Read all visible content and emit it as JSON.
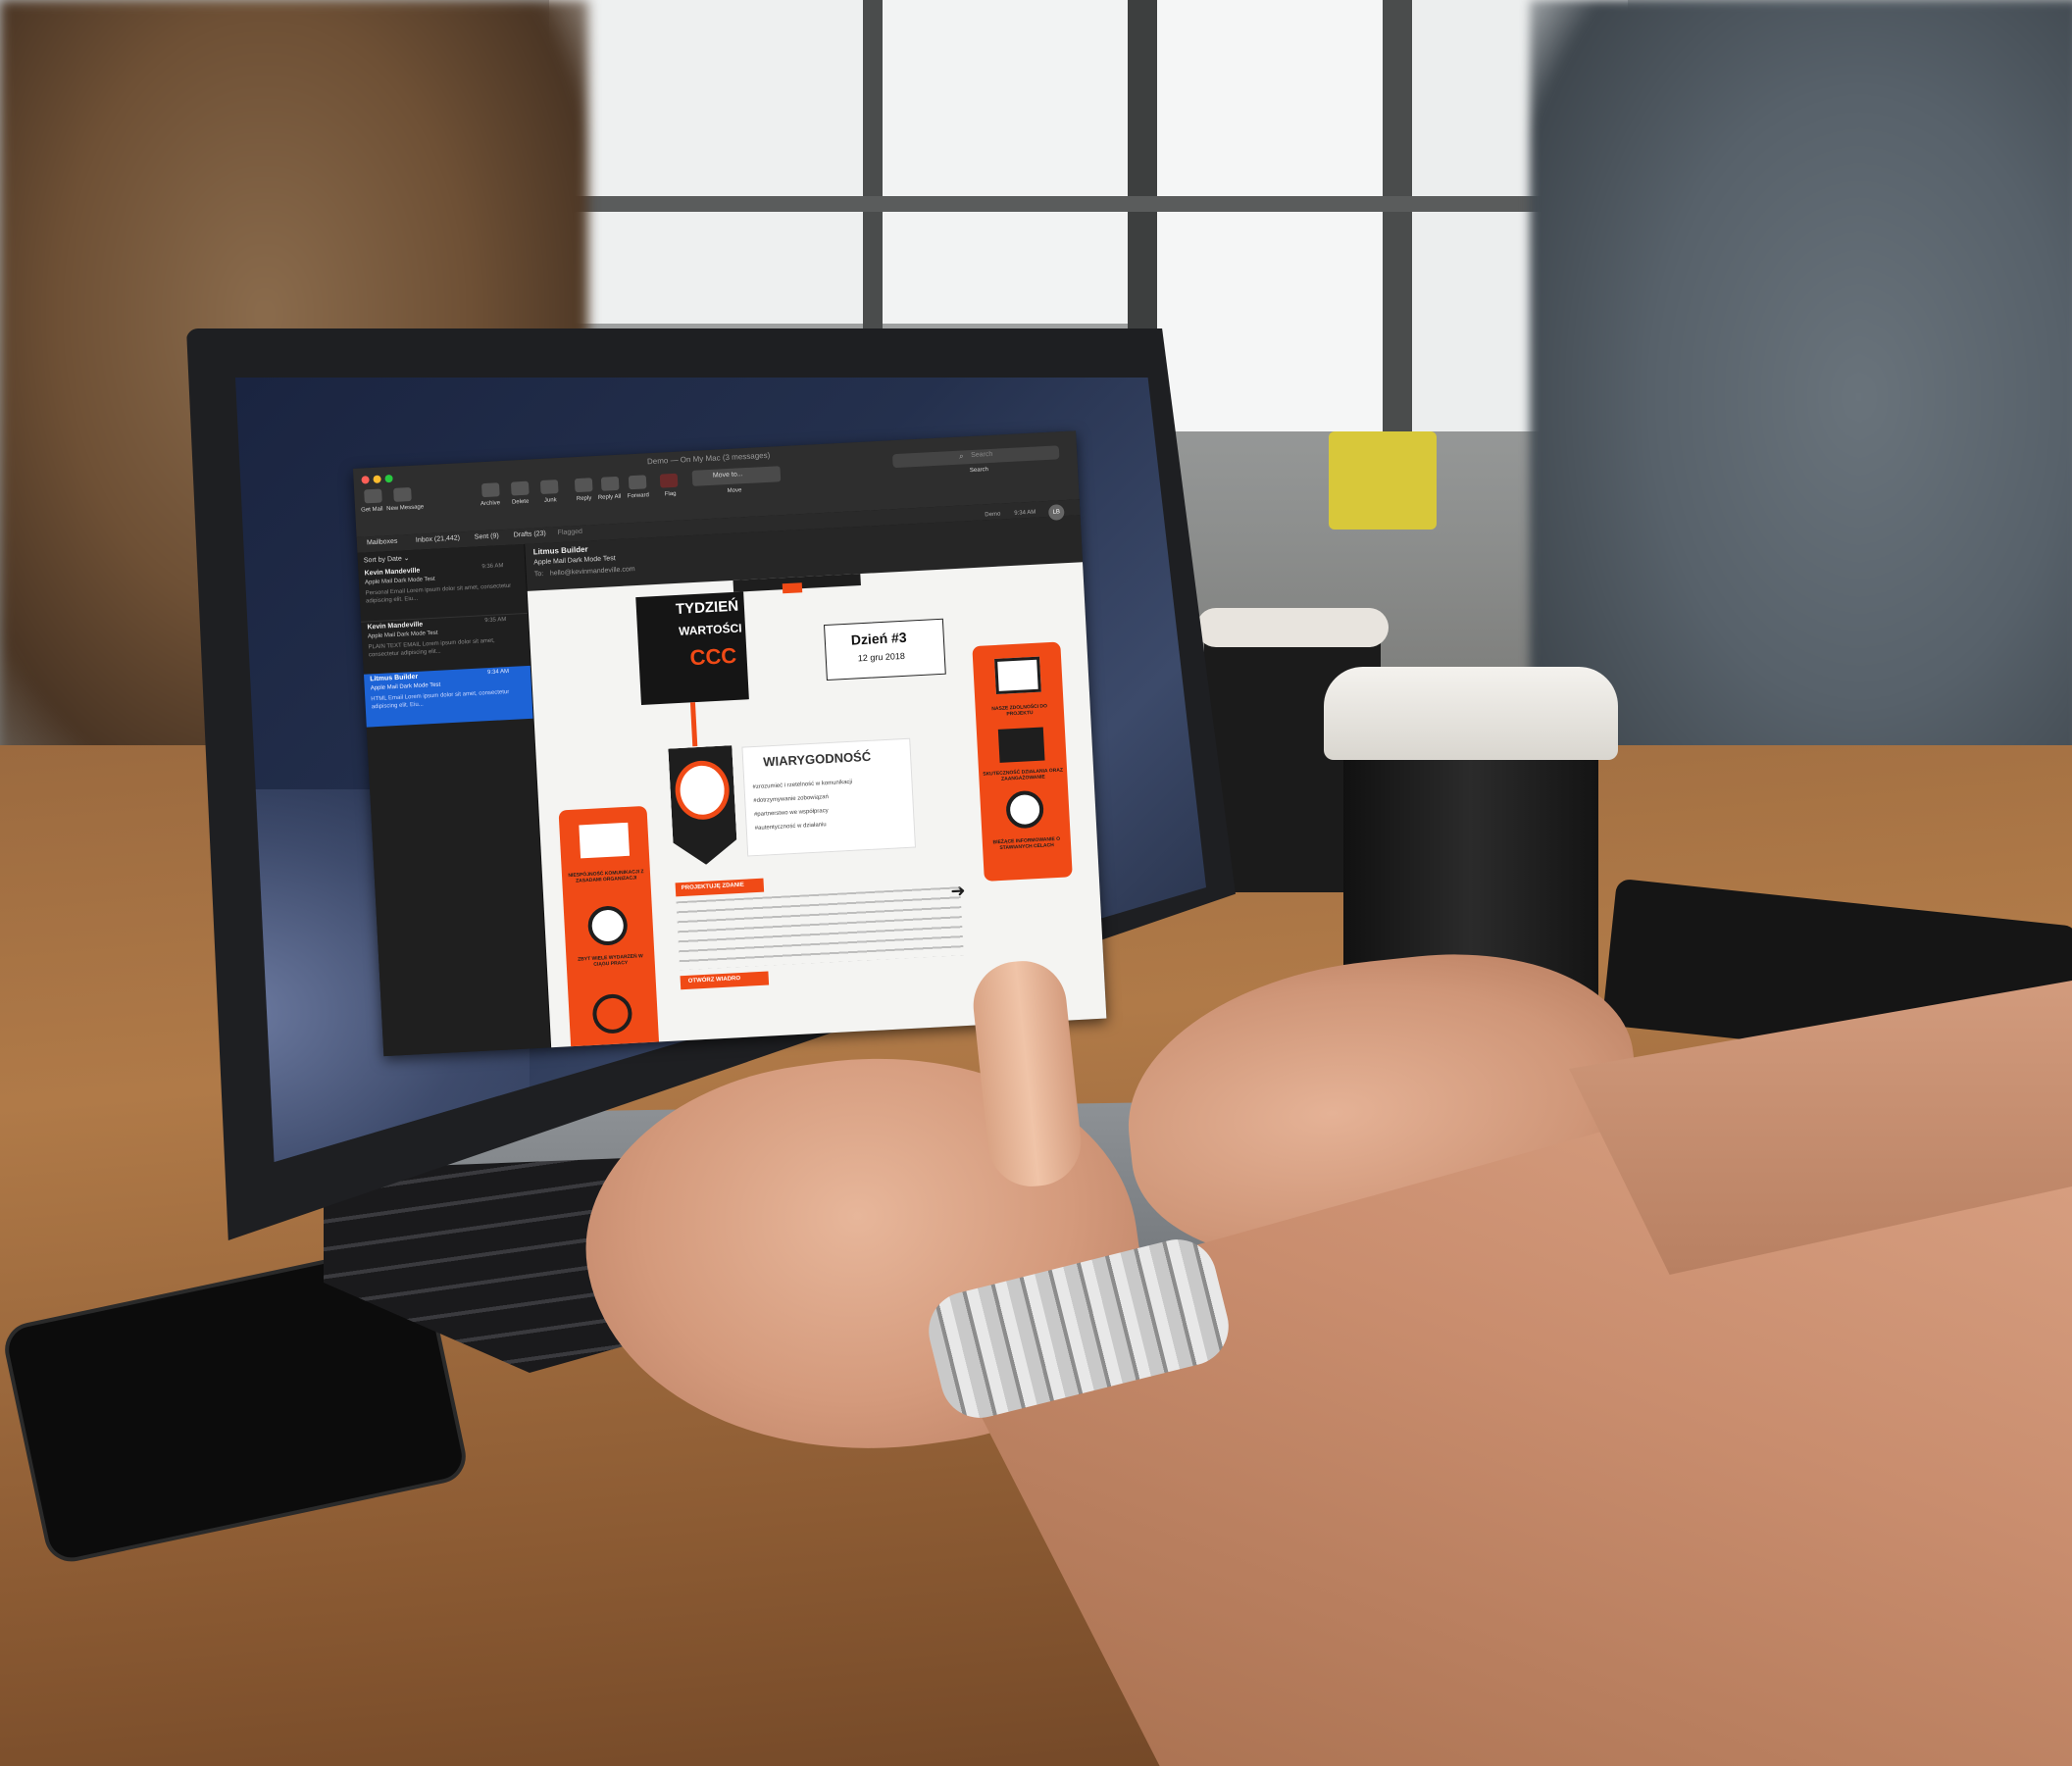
{
  "mail": {
    "window_title": "Demo — On My Mac (3 messages)",
    "search_placeholder": "Search",
    "search_label": "Search",
    "toolbar": {
      "get_mail": "Get Mail",
      "new_message": "New Message",
      "archive": "Archive",
      "delete": "Delete",
      "junk": "Junk",
      "reply": "Reply",
      "reply_all": "Reply All",
      "forward": "Forward",
      "flag": "Flag",
      "move_to": "Move to...",
      "move": "Move"
    },
    "favorites": {
      "mailboxes": "Mailboxes",
      "inbox": "Inbox (21,442)",
      "sent": "Sent (9)",
      "drafts": "Drafts (23)",
      "flagged": "Flagged"
    },
    "sort_label": "Sort by Date ⌄",
    "messages": [
      {
        "sender": "Kevin Mandeville",
        "time": "9:36 AM",
        "subject": "Apple Mail Dark Mode Test",
        "preview": "Personal Email Lorem ipsum dolor sit amet, consectetur adipiscing elit. Eiu..."
      },
      {
        "sender": "Kevin Mandeville",
        "time": "9:35 AM",
        "subject": "Apple Mail Dark Mode Test",
        "preview": "PLAIN TEXT EMAIL Lorem ipsum dolor sit amet, consectetur adipiscing elit..."
      },
      {
        "sender": "Litmus Builder",
        "time": "9:34 AM",
        "subject": "Apple Mail Dark Mode Test",
        "preview": "HTML Email Lorem ipsum dolor sit amet, consectetur adipiscing elit. Eiu..."
      }
    ],
    "reader": {
      "from": "Litmus Builder",
      "subject": "Apple Mail Dark Mode Test",
      "to_label": "To:",
      "to": "hello@kevinmandeville.com",
      "inbox_tag": "Demo",
      "time": "9:34 AM",
      "avatar": "LB"
    }
  },
  "email": {
    "title_line1": "TYDZIEŃ",
    "title_line2": "WARTOŚCI",
    "title_brand": "CCC",
    "day_label": "Dzień #3",
    "date_label": "12 gru 2018",
    "value_title": "WIARYGODNOŚĆ",
    "bullets": [
      "#zrozumieć i rzetelność w komunikacji",
      "#dotrzymywanie zobowiązań",
      "#partnerstwo we współpracy",
      "#autentyczność w działaniu"
    ],
    "projects_tag": "PROJEKTUJĘ ZDANIE",
    "open_tag": "OTWÓRZ WIADRO",
    "left_icons": [
      "NIESPÓJNOŚĆ KOMUNIKACJI Z ZASADAMI ORGANIZACJI",
      "ZBYT WIELE WYDARZEŃ W CIĄGU PRACY"
    ],
    "right_icons": [
      "NASZE ZDOLNOŚCI DO PROJEKTU",
      "SKUTECZNOŚĆ DZIAŁANIA ORAZ ZAANGAŻOWANIE",
      "BIEŻĄCE INFORMOWANIE O STAWIANYCH CELACH"
    ],
    "colors": {
      "accent": "#f04a16",
      "dark": "#1e1e1e",
      "paper": "#f4f4f2"
    }
  }
}
